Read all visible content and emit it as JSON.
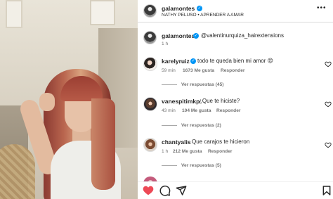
{
  "post": {
    "author": "galamontes",
    "audio": "NATHY PELUSO • APRENDER A AMAR",
    "more_icon": "more-horizontal-icon"
  },
  "caption": {
    "author": "galamontes",
    "text": "@valentinurquiza_hairextensions",
    "time": "1 h"
  },
  "comments": [
    {
      "user": "karelyruiz",
      "verified": true,
      "text": "todo te queda bien mi amor 😍",
      "time": "59 min",
      "likes": "1673 Me gusta",
      "reply": "Responder",
      "replies": "Ver respuestas (45)"
    },
    {
      "user": "vanespitimkp",
      "verified": false,
      "text": "¿Que te hiciste?",
      "time": "43 min",
      "likes": "104 Me gusta",
      "reply": "Responder",
      "replies": "Ver respuestas (2)"
    },
    {
      "user": "chantyalis",
      "verified": false,
      "text": "Que carajos te hicieron",
      "time": "1 h",
      "likes": "212 Me gusta",
      "reply": "Responder",
      "replies": "Ver respuestas (5)"
    }
  ],
  "actions": {
    "like_icon": "heart-filled-icon",
    "comment_icon": "comment-icon",
    "share_icon": "share-icon",
    "save_icon": "bookmark-icon"
  },
  "colors": {
    "like_red": "#ed4956",
    "verified_blue": "#0095f6",
    "meta_gray": "#737373"
  }
}
